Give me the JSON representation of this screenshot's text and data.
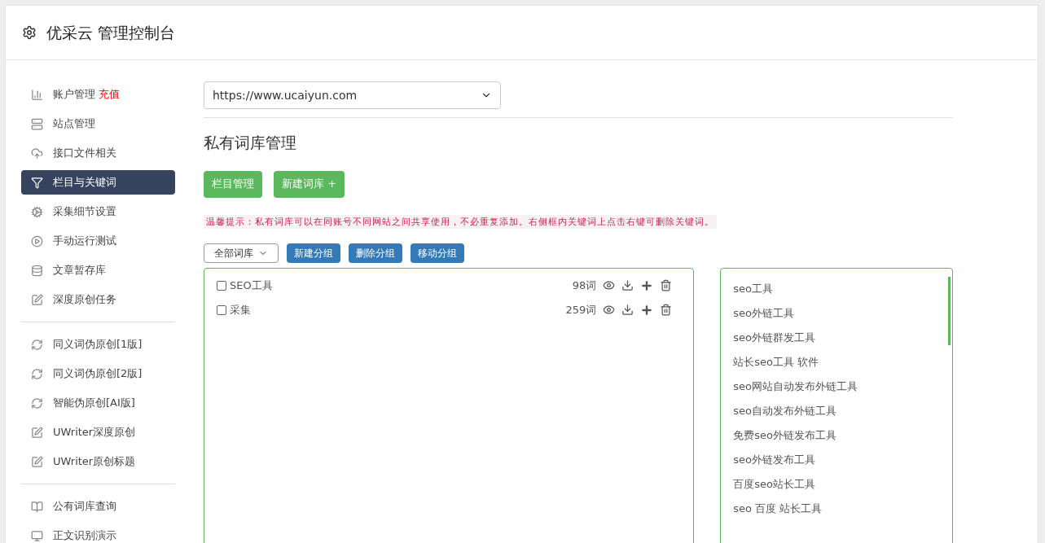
{
  "header": {
    "title": "优采云 管理控制台"
  },
  "sidebar": {
    "groups": [
      {
        "items": [
          {
            "label": "账户管理",
            "badge": "充值",
            "selected": false
          },
          {
            "label": "站点管理",
            "selected": false
          },
          {
            "label": "接口文件相关",
            "selected": false
          },
          {
            "label": "栏目与关键词",
            "selected": true
          },
          {
            "label": "采集细节设置",
            "selected": false
          },
          {
            "label": "手动运行测试",
            "selected": false
          },
          {
            "label": "文章暂存库",
            "selected": false
          },
          {
            "label": "深度原创任务",
            "selected": false
          }
        ]
      },
      {
        "items": [
          {
            "label": "同义词伪原创[1版]",
            "selected": false
          },
          {
            "label": "同义词伪原创[2版]",
            "selected": false
          },
          {
            "label": "智能伪原创[AI版]",
            "selected": false
          },
          {
            "label": "UWriter深度原创",
            "selected": false
          },
          {
            "label": "UWriter原创标题",
            "selected": false
          }
        ]
      },
      {
        "items": [
          {
            "label": "公有词库查询",
            "selected": false
          },
          {
            "label": "正文识别演示",
            "selected": false
          }
        ]
      }
    ]
  },
  "site_select": {
    "value": "https://www.ucaiyun.com"
  },
  "section_title": "私有词库管理",
  "top_buttons": [
    "栏目管理",
    "新建词库 +"
  ],
  "tip": "温馨提示：私有词库可以在同账号不同网站之间共享使用，不必重复添加。右侧框内关键词上点击右键可删除关键词。",
  "filter_select": {
    "value": "全部词库"
  },
  "group_buttons": [
    "新建分组",
    "删除分组",
    "移动分组"
  ],
  "libraries": [
    {
      "name": "SEO工具",
      "count": "98词",
      "checked": false
    },
    {
      "name": "采集",
      "count": "259词",
      "checked": false
    }
  ],
  "keywords": [
    "seo工具",
    "seo外链工具",
    "seo外链群发工具",
    "站长seo工具 软件",
    "seo网站自动发布外链工具",
    "seo自动发布外链工具",
    "免费seo外链发布工具",
    "seo外链发布工具",
    "百度seo站长工具",
    "seo 百度 站长工具"
  ]
}
